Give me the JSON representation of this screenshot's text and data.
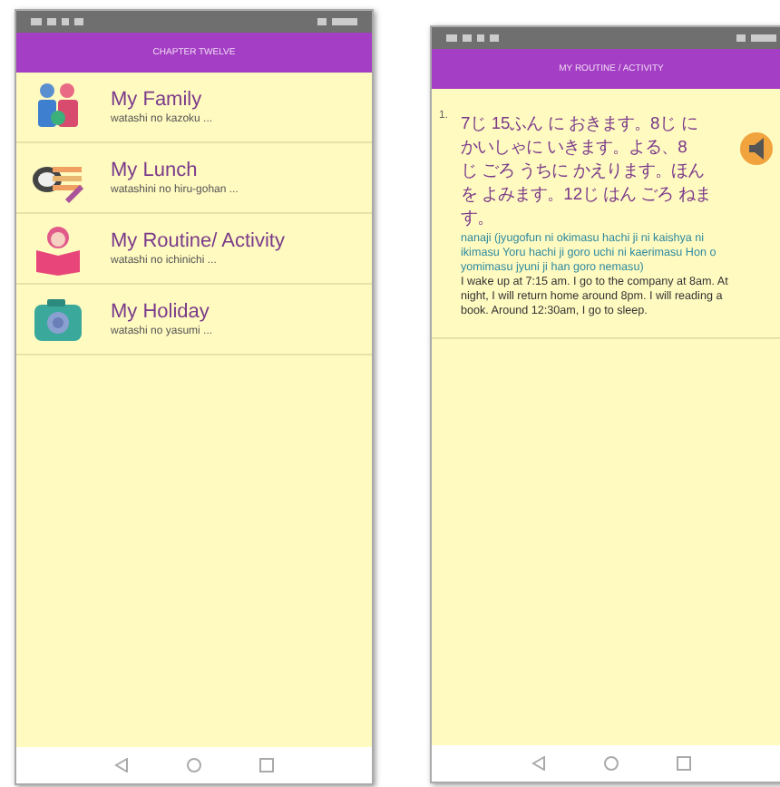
{
  "screens": [
    {
      "kind": "menu",
      "title": "CHAPTER TWELVE",
      "items": [
        {
          "kind": "family",
          "title": "My Family",
          "subtitle": "watashi no kazoku ..."
        },
        {
          "kind": "lunch",
          "title": "My Lunch",
          "subtitle": "watashini no hiru-gohan ..."
        },
        {
          "kind": "book",
          "title": "My Routine/ Activity",
          "subtitle": "watashi no ichinichi ..."
        },
        {
          "kind": "camera",
          "title": "My Holiday",
          "subtitle": "watashi no yasumi ..."
        }
      ]
    },
    {
      "kind": "lesson",
      "title": "MY ROUTINE / ACTIVITY",
      "entries": [
        {
          "number": "1.",
          "japanese_lines": [
            "7じ 15ふん に おきます。8じ に",
            "かいしゃに いきます。よる、8",
            "じ ごろ うちに かえります。ほん",
            "を よみます。12じ はん ごろ ねま",
            "す。"
          ],
          "romaji": "nanaji (jyugofun ni okimasu hachi ji ni kaishya ni ikimasu Yoru hachi ji goro uchi ni kaerimasu Hon o yomimasu jyuni ji han goro nemasu)",
          "english": "I wake up at 7:15 am. I go to the company at 8am. At night, I will return home around 8pm. I will reading a book. Around 12:30am, I go to sleep."
        }
      ]
    }
  ]
}
